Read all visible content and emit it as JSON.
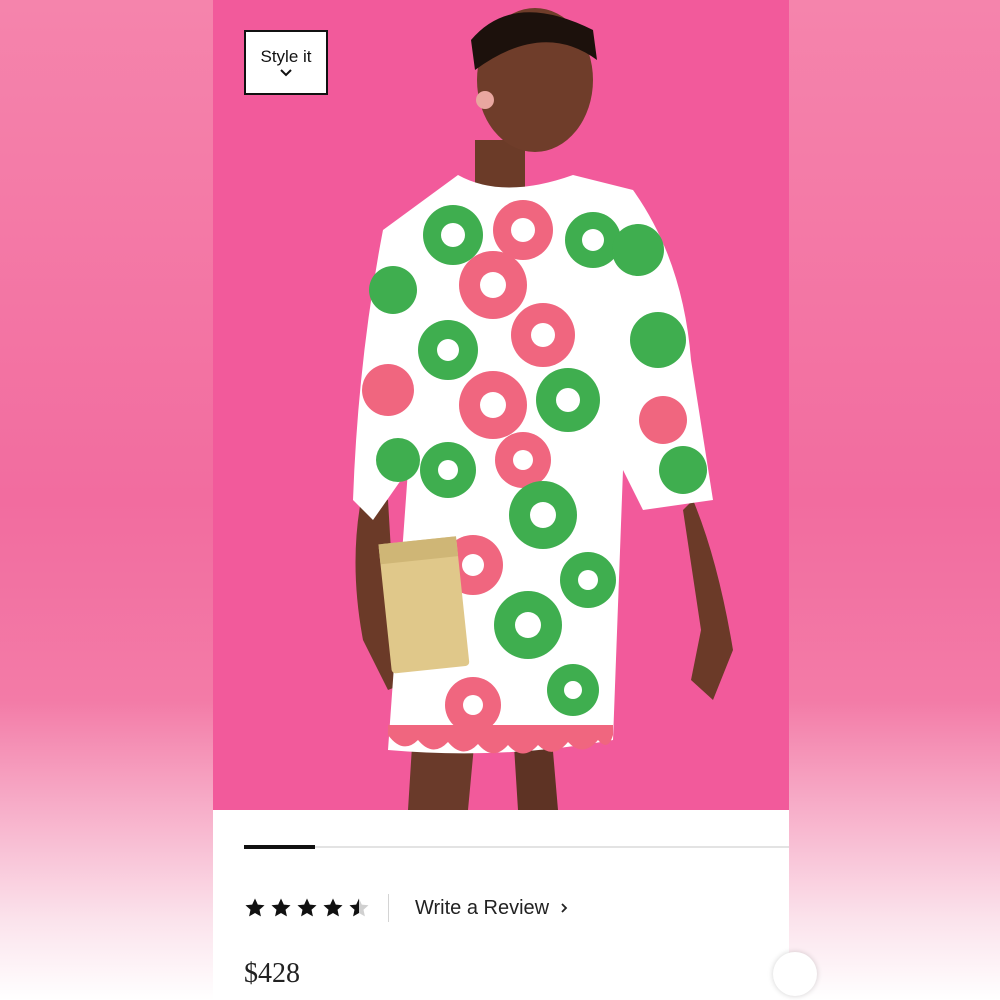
{
  "style_it": {
    "label": "Style it",
    "icon": "chevron-down-icon"
  },
  "gallery": {
    "progress": 0.13
  },
  "rating": {
    "value": 4.5,
    "max": 5
  },
  "review": {
    "label": "Write a Review",
    "icon": "chevron-right-icon"
  },
  "price": "$428",
  "colors": {
    "background_pink": "#f25a9b",
    "dress_green": "#3fae4f",
    "dress_pink": "#f0667f"
  }
}
